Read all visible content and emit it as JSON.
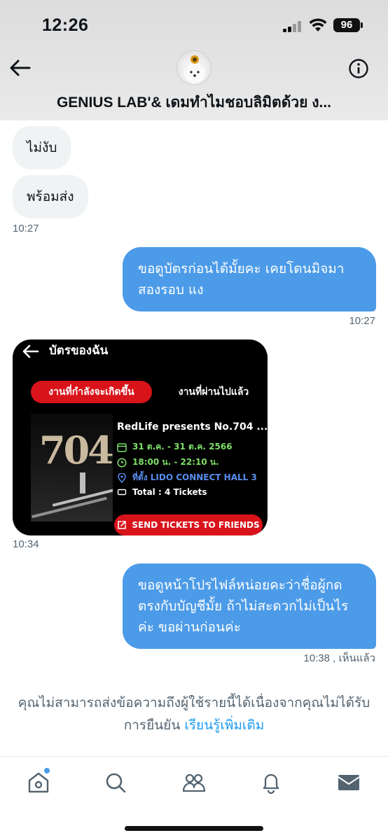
{
  "status_bar": {
    "time": "12:26",
    "battery": "96"
  },
  "header": {
    "title": "GENIUS LAB'& เดมทำไมชอบลิมิตด้วย ง..."
  },
  "messages": {
    "m1": {
      "text": "ไม่งับ"
    },
    "m2": {
      "text": "พร้อมส่ง",
      "time": "10:27"
    },
    "m3": {
      "text_line1": "ขอดูบัตรก่อนได้มั้ยคะ เคยโดนมิจมา",
      "text_line2": "สองรอบ แง",
      "time": "10:27"
    },
    "m4": {
      "time": "10:34",
      "ticket": {
        "title": "บัตรของฉัน",
        "tab_active": "งานที่กำลังจะเกิดขึ้น",
        "tab_inactive": "งานที่ผ่านไปแล้ว",
        "poster_text": "704",
        "event_name": "RedLife presents No.704 ...",
        "date": "31 ต.ค. - 31 ต.ค. 2566",
        "time_range": "18:00 น. - 22:10 น.",
        "venue": "ที่ตั้ง LIDO CONNECT HALL 3",
        "total": "Total : 4 Tickets",
        "send_button": "SEND TICKETS TO FRIENDS"
      }
    },
    "m5": {
      "text_line1": "ขอดูหน้าโปรไฟล์หน่อยคะว่าชื่อผู้กด",
      "text_line2": "ตรงกับบัญชีมั้ย ถ้าไม่สะดวกไม่เป็นไร",
      "text_line3": "ค่ะ ขอผ่านก่อนค่ะ",
      "time": "10:38 , เห็นแล้ว"
    }
  },
  "notice": {
    "line1": "คุณไม่สามารถส่งข้อความถึงผู้ใช้รายนี้ได้เนื่องจากคุณไม่ได้รับ",
    "line2_prefix": "การยืนยัน ",
    "link": "เรียนรู้เพิ่มเติม"
  },
  "bottom_nav": {
    "icons": [
      "home-icon",
      "search-icon",
      "communities-icon",
      "notifications-icon",
      "messages-icon"
    ],
    "accent": "#1d9bf0"
  },
  "colors": {
    "outgoing_bubble": "#4c9be8",
    "incoming_bubble": "#eff3f4",
    "ticket_red": "#d8131a"
  }
}
